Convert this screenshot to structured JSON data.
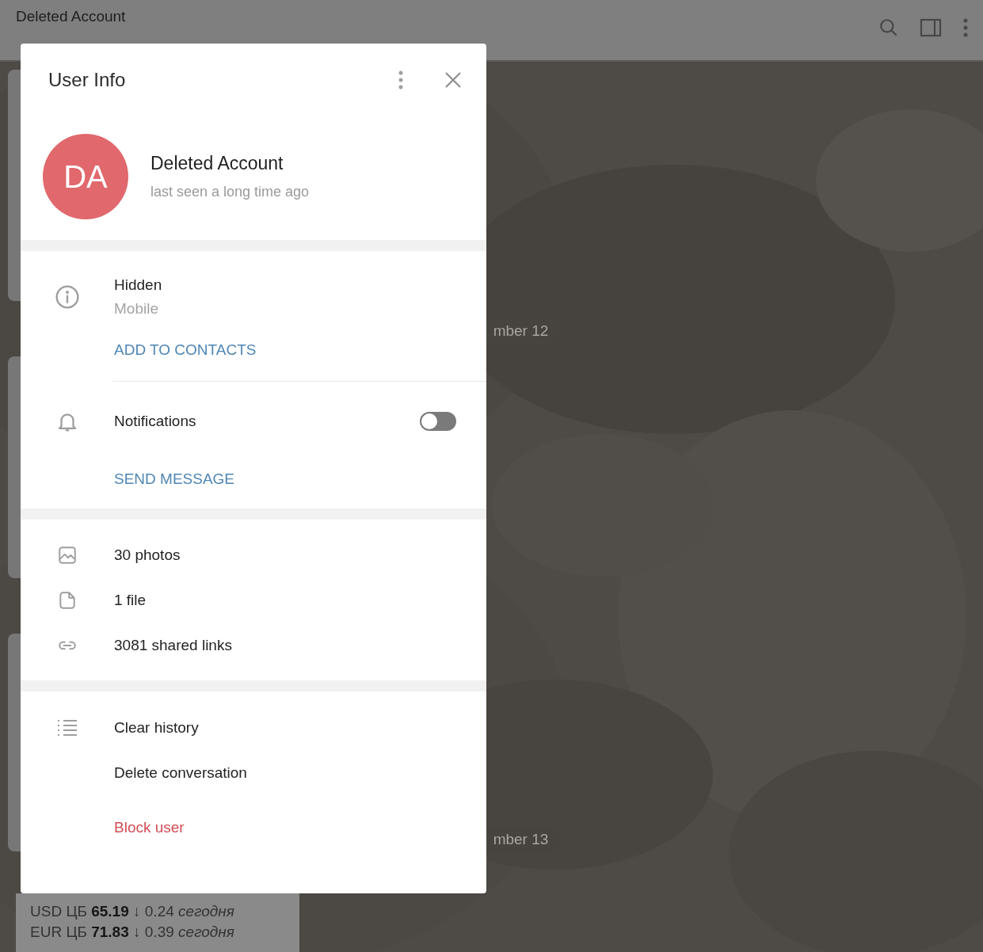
{
  "header": {
    "title": "Deleted Account"
  },
  "date_pills": [
    {
      "text": "mber 12"
    },
    {
      "text": "mber 13"
    }
  ],
  "message": {
    "lines": [
      "USD ЦБ **65.19** ↓ 0.24 *сегодня*",
      "EUR ЦБ **71.83** ↓ 0.39 *сегодня*"
    ]
  },
  "dialog": {
    "title": "User Info",
    "avatar_initials": "DA",
    "name": "Deleted Account",
    "status": "last seen a long time ago",
    "info": {
      "value": "Hidden",
      "label": "Mobile",
      "action": "ADD TO CONTACTS"
    },
    "notifications": {
      "label": "Notifications",
      "on": false
    },
    "send_message": "SEND MESSAGE",
    "media": [
      {
        "kind": "photos",
        "label": "30 photos"
      },
      {
        "kind": "files",
        "label": "1 file"
      },
      {
        "kind": "links",
        "label": "3081 shared links"
      }
    ],
    "actions": [
      {
        "kind": "history",
        "label": "Clear history"
      },
      {
        "kind": "delete",
        "label": "Delete conversation"
      },
      {
        "kind": "block",
        "label": "Block user"
      }
    ]
  }
}
